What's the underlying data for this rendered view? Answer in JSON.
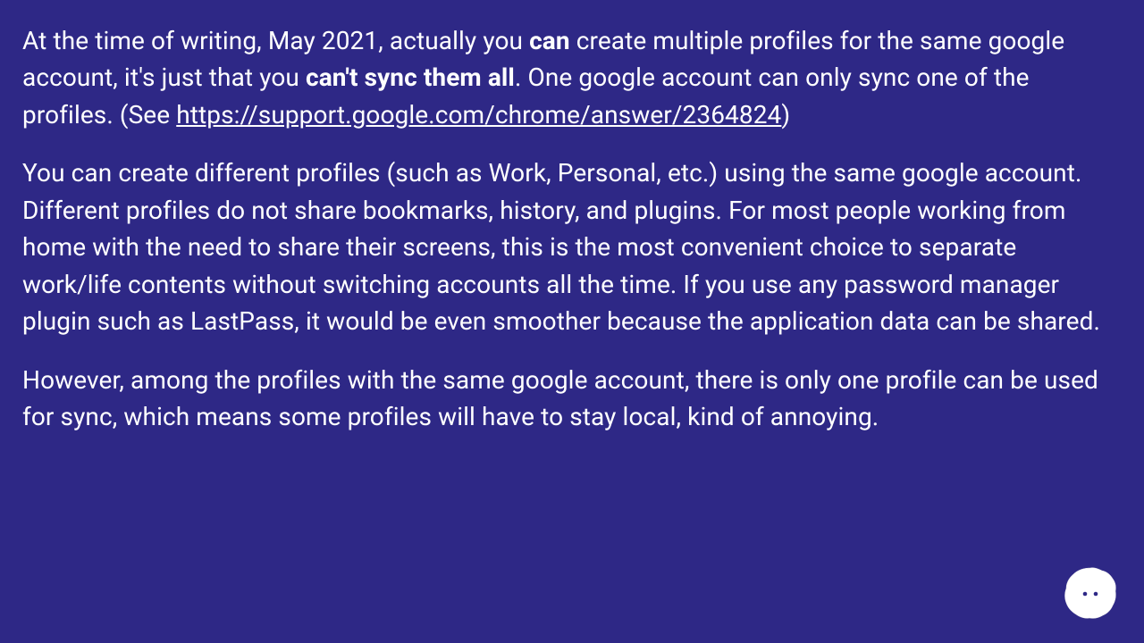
{
  "paragraphs": {
    "p1": {
      "s1": "At the time of writing, May 2021, actually you ",
      "b1": "can",
      "s2": " create multiple profiles for the same google account, it's just that you ",
      "b2": "can't sync them all",
      "s3": ". One google account can only sync one of the profiles. (See ",
      "link": "https://support.google.com/chrome/answer/2364824",
      "s4": ")"
    },
    "p2": "You can create different profiles (such as Work, Personal, etc.) using the same google account. Different profiles do not share bookmarks, history, and plugins. For most people working from home with the need to share their screens, this is the most convenient choice to separate work/life contents without switching accounts all the time. If you use any password manager plugin such as LastPass, it would be even smoother because the application data can be shared.",
    "p3": "However, among the profiles with the same google account, there is only one profile can be used for sync, which means some profiles will have to stay local, kind of annoying."
  }
}
